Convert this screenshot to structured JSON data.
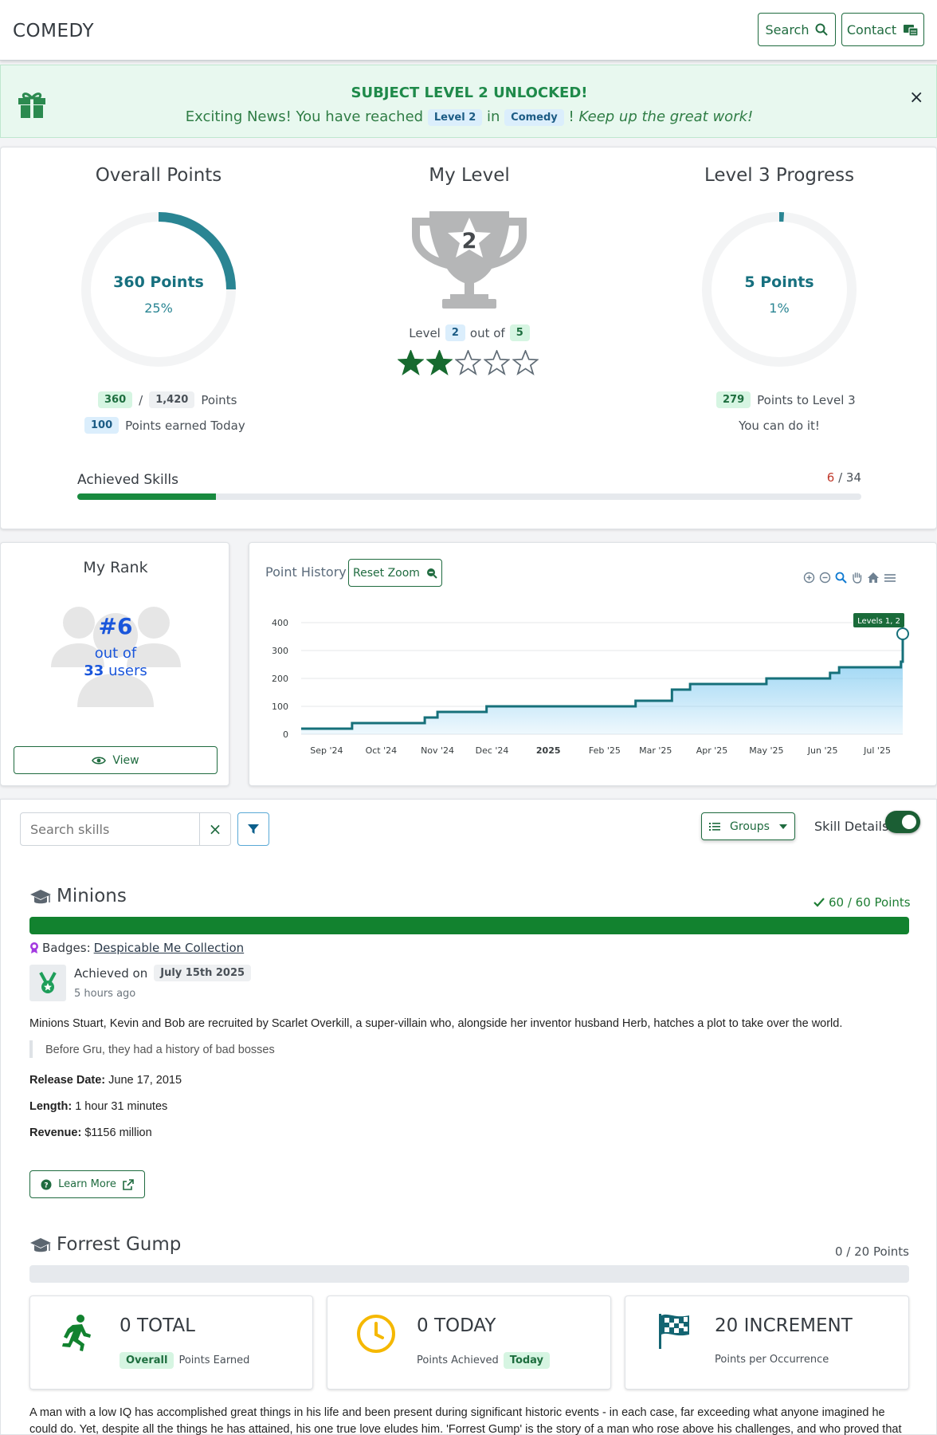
{
  "navbar": {
    "brand": "COMEDY",
    "search_label": "Search",
    "contact_label": "Contact"
  },
  "alert": {
    "title": "SUBJECT LEVEL 2 UNLOCKED!",
    "msg_prefix": "Exciting News! You have reached",
    "level_tag": "Level 2",
    "msg_in": "in",
    "subject_tag": "Comedy",
    "msg_suffix": "Keep up the great work!",
    "close": "×"
  },
  "overall": {
    "title": "Overall Points",
    "points_label": "360 Points",
    "percent_label": "25%",
    "percent": 0.25,
    "earned": "360",
    "total": "1,420",
    "points_word": "Points",
    "today": "100",
    "today_label": "Points earned Today"
  },
  "level": {
    "title": "My Level",
    "trophy_number": "2",
    "level_word": "Level",
    "level": "2",
    "out_of": "out of",
    "max": "5",
    "stars_filled": 2,
    "stars_total": 5
  },
  "level_progress": {
    "title": "Level 3 Progress",
    "points_label": "5 Points",
    "percent_label": "1%",
    "percent": 0.01,
    "remaining": "279",
    "remaining_label": "Points to Level 3",
    "encourage": "You can do it!"
  },
  "skills": {
    "label": "Achieved Skills",
    "achieved": "6",
    "sep": "/",
    "total": "34",
    "fraction": 0.1765
  },
  "rank": {
    "title": "My Rank",
    "rank": "#6",
    "out_of": "out of",
    "users_count": "33",
    "users_word": "users",
    "view_label": "View"
  },
  "history": {
    "title": "Point History",
    "reset_label": "Reset Zoom"
  },
  "chart_data": {
    "type": "area",
    "title": "",
    "xlabel": "",
    "ylabel": "",
    "ylim": [
      0,
      400
    ],
    "yticks": [
      0,
      100,
      200,
      300,
      400
    ],
    "xticks": [
      "Sep '24",
      "Oct '24",
      "Nov '24",
      "Dec '24",
      "2025",
      "Feb '25",
      "Mar '25",
      "Apr '25",
      "May '25",
      "Jun '25",
      "Jul '25"
    ],
    "x": [
      "2024-08-18",
      "2024-09-15",
      "2024-10-05",
      "2024-10-25",
      "2024-11-01",
      "2024-11-28",
      "2025-02-10",
      "2025-02-18",
      "2025-03-10",
      "2025-03-20",
      "2025-05-01",
      "2025-06-05",
      "2025-06-10",
      "2025-07-14",
      "2025-07-15"
    ],
    "values": [
      20,
      40,
      40,
      60,
      80,
      100,
      100,
      120,
      160,
      180,
      200,
      220,
      240,
      260,
      360
    ],
    "grid": true,
    "annotation": "Levels 1, 2",
    "colors": {
      "line": "#16707a",
      "fill": "#79c7f0"
    }
  },
  "controls": {
    "search_placeholder": "Search skills",
    "clear": "×",
    "groups_label": "Groups",
    "skill_details_label": "Skill Details:"
  },
  "subjects": [
    {
      "title": "Minions",
      "points_label": "60 / 60 Points",
      "progress": 1.0,
      "badges_label": "Badges:",
      "badge_link": "Despicable Me Collection",
      "achieved_on": "Achieved on",
      "achieved_date": "July 15th 2025",
      "ago": "5 hours ago",
      "description": "Minions Stuart, Kevin and Bob are recruited by Scarlet Overkill, a super-villain who, alongside her inventor husband Herb, hatches a plot to take over the world.",
      "quote": "Before Gru, they had a history of bad bosses",
      "release_label": "Release Date:",
      "release": "June 17, 2015",
      "length_label": "Length:",
      "length": "1 hour 31 minutes",
      "revenue_label": "Revenue:",
      "revenue": "$1156 million",
      "learn_more": "Learn More"
    },
    {
      "title": "Forrest Gump",
      "points_label": "0 / 20 Points",
      "progress": 0,
      "total_value": "0 TOTAL",
      "total_tag": "Overall",
      "total_sub": "Points Earned",
      "today_value": "0 TODAY",
      "today_sub": "Points Achieved",
      "today_tag": "Today",
      "increment_value": "20 INCREMENT",
      "increment_sub": "Points per Occurrence",
      "description": "A man with a low IQ has accomplished great things in his life and been present during significant historic events - in each case, far exceeding what anyone imagined he could do. Yet, despite all the things he has attained, his one true love eludes him. 'Forrest Gump' is the story of a man who rose above his challenges, and who proved that"
    }
  ],
  "icons": {
    "gift": "gift-icon",
    "search": "search-icon",
    "contact": "contact-icon",
    "trophy": "trophy-icon",
    "star": "star-icon",
    "users": "users-icon",
    "eye": "eye-icon",
    "cap": "graduation-cap-icon",
    "check": "check-icon",
    "badge": "badge-icon",
    "medal": "medal-icon",
    "runner": "running-icon",
    "clock": "clock-icon",
    "flag": "checkered-flag-icon",
    "filter": "filter-icon",
    "list": "list-icon",
    "external": "external-link-icon",
    "question": "question-icon"
  }
}
